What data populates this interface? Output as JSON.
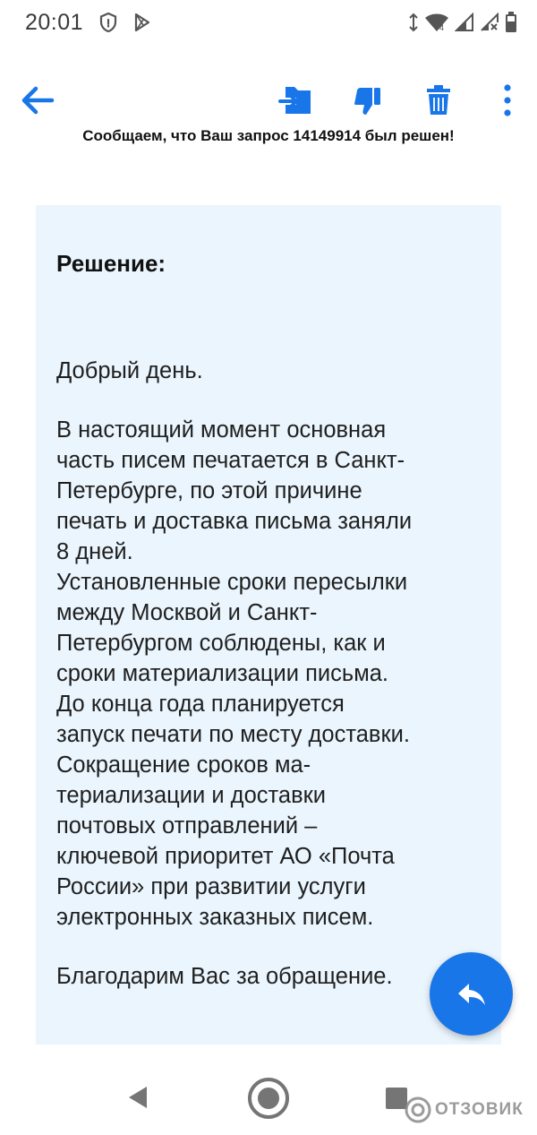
{
  "status_bar": {
    "time": "20:01",
    "icons": [
      "shield-icon",
      "play-icon",
      "vibrate-icon",
      "wifi-icon",
      "signal-icon",
      "signal-no-sim-icon",
      "battery-icon"
    ]
  },
  "toolbar": {
    "back_icon": "arrow-left-icon",
    "actions": [
      "move-to-folder-icon",
      "thumb-down-icon",
      "trash-icon",
      "more-vert-icon"
    ],
    "accent_color": "#1976e8"
  },
  "subject": "Сообщаем, что Ваш запрос 14149914 был решен!",
  "message": {
    "heading": "Решение:",
    "greeting": "Добрый день.",
    "paragraph_lines": [
      "В настоящий момент основная",
      "часть писем печатается в Санкт-",
      "Петербурге, по этой причине",
      "печать и доставка письма заняли",
      "8 дней.",
      "Установленные сроки пересылки",
      "между Москвой и Санкт-",
      "Петербургом соблюдены, как и",
      "сроки материализации письма.",
      "До конца года планируется",
      "запуск печати по месту доставки.",
      "Сокращение сроков ма-",
      "териализации и доставки",
      "почтовых отправлений –",
      "ключевой приоритет АО «Почта",
      "России» при развитии услуги",
      "электронных заказных писем."
    ],
    "closing": "Благодарим Вас за обращение.",
    "card_background": "#eaf5fd"
  },
  "reply_button": {
    "icon": "reply-icon"
  },
  "nav_bar": {
    "icons": [
      "nav-back-icon",
      "nav-home-icon",
      "nav-recents-icon"
    ]
  },
  "watermark": {
    "text": "ОТЗОВИК"
  }
}
